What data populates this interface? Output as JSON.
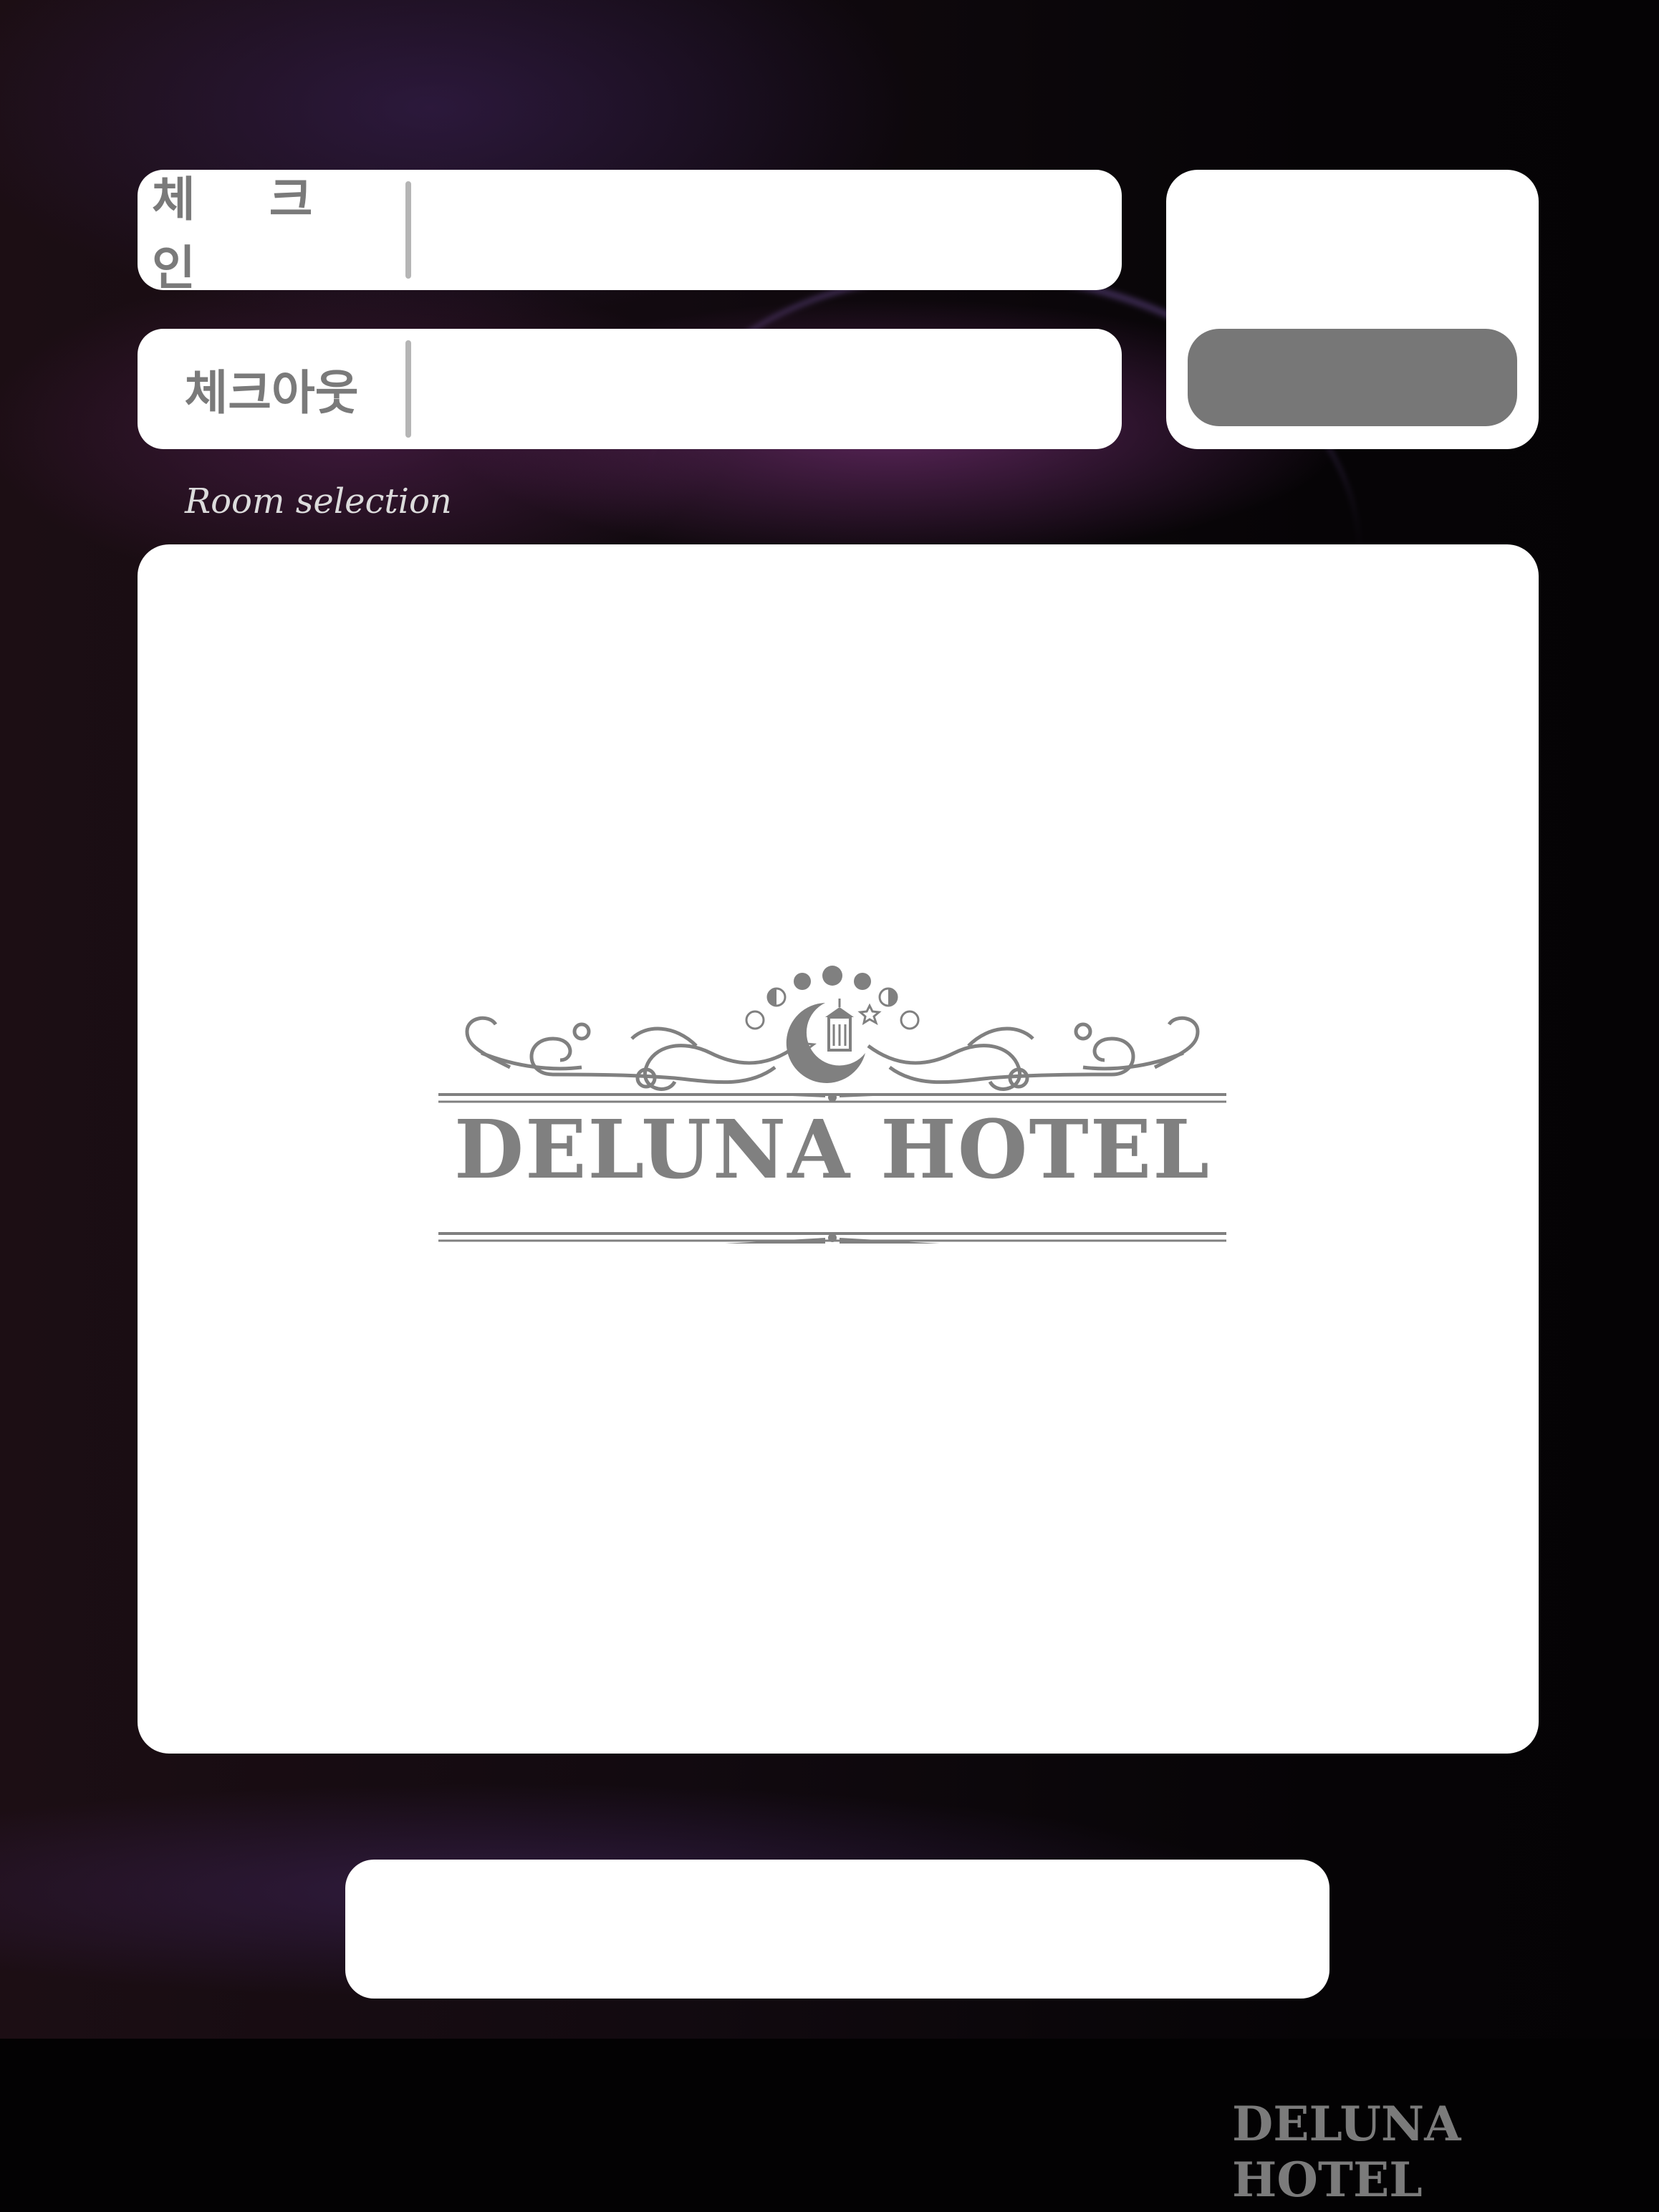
{
  "checkin": {
    "label": "체 크 인",
    "value": ""
  },
  "checkout": {
    "label": "체크아웃",
    "value": ""
  },
  "side_panel": {
    "button_label": ""
  },
  "room_selection": {
    "label": "Room selection"
  },
  "logo": {
    "text": "DELUNA HOTEL",
    "icon": "crescent-moon-lantern-icon"
  },
  "bottom_field": {
    "value": ""
  },
  "footer": {
    "brand": "DELUNA HOTEL"
  },
  "colors": {
    "panel": "#ffffff",
    "label_gray": "#7a7a7a",
    "button_gray": "#777777",
    "background": "#0b0709"
  }
}
